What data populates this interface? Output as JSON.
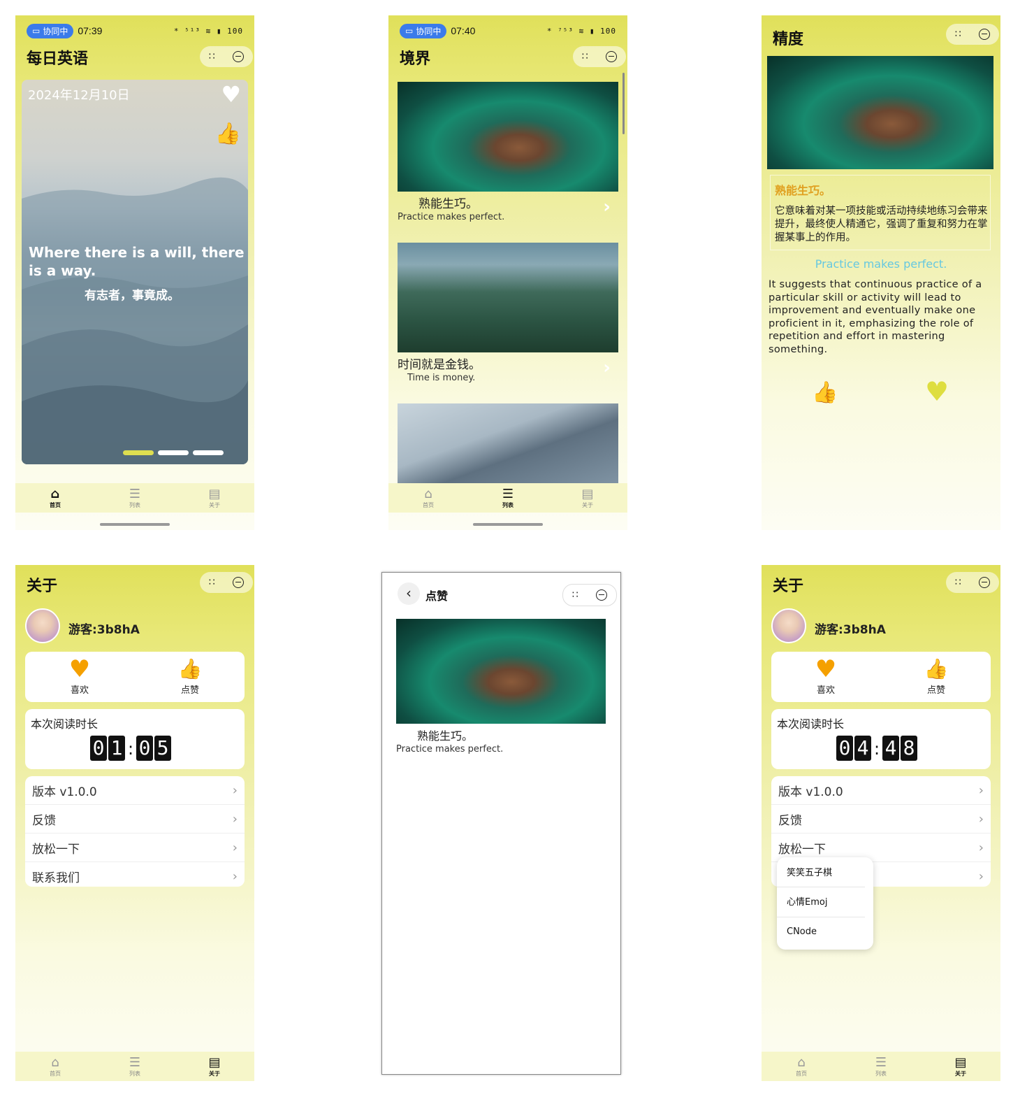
{
  "status": {
    "collab_label": "协同中",
    "time_1": "07:39",
    "time_2": "07:40",
    "icons_1": "* ⁵¹³ ≋ ▮ 100",
    "icons_2": "* ⁷⁵³ ≋ ▮ 100"
  },
  "home": {
    "title": "每日英语",
    "date": "2024年12月10日",
    "quote_en": "Where there is a will, there is a way.",
    "quote_cn": "有志者，事竟成。",
    "carousel_active_index": 0,
    "carousel_count": 3
  },
  "tabs": [
    "首页",
    "列表",
    "关于"
  ],
  "list": {
    "title": "境界",
    "items": [
      {
        "cn": "熟能生巧。",
        "en": "Practice makes perfect."
      },
      {
        "cn": "时间就是金钱。",
        "en": "Time is money."
      }
    ]
  },
  "detail": {
    "title": "精度",
    "cn_title": "熟能生巧。",
    "cn_desc": "它意味着对某一项技能或活动持续地练习会带来提升，最终使人精通它，强调了重复和努力在掌握某事上的作用。",
    "en_title": "Practice makes perfect.",
    "en_desc": "It suggests that continuous practice of a particular skill or activity will lead to improvement and eventually make one proficient in it, emphasizing the role of repetition and effort in mastering something."
  },
  "about": {
    "title": "关于",
    "user": "游客:3b8hA",
    "like_label": "喜欢",
    "thumb_label": "点赞",
    "reading_label": "本次阅读时长",
    "timer_1": [
      "0",
      "1",
      "0",
      "5"
    ],
    "timer_2": [
      "0",
      "4",
      "4",
      "8"
    ],
    "menu": [
      "版本 v1.0.0",
      "反馈",
      "放松一下",
      "联系我们"
    ]
  },
  "likes_page": {
    "title": "点赞",
    "item": {
      "cn": "熟能生巧。",
      "en": "Practice makes perfect."
    }
  },
  "popup": {
    "items": [
      "笑笑五子棋",
      "心情Emoj",
      "CNode"
    ]
  },
  "colors": {
    "accent_yellow": "#e0e05a",
    "heart_orange": "#f5a000",
    "thumb_red": "#e11",
    "carousel_active": "#dede50"
  }
}
